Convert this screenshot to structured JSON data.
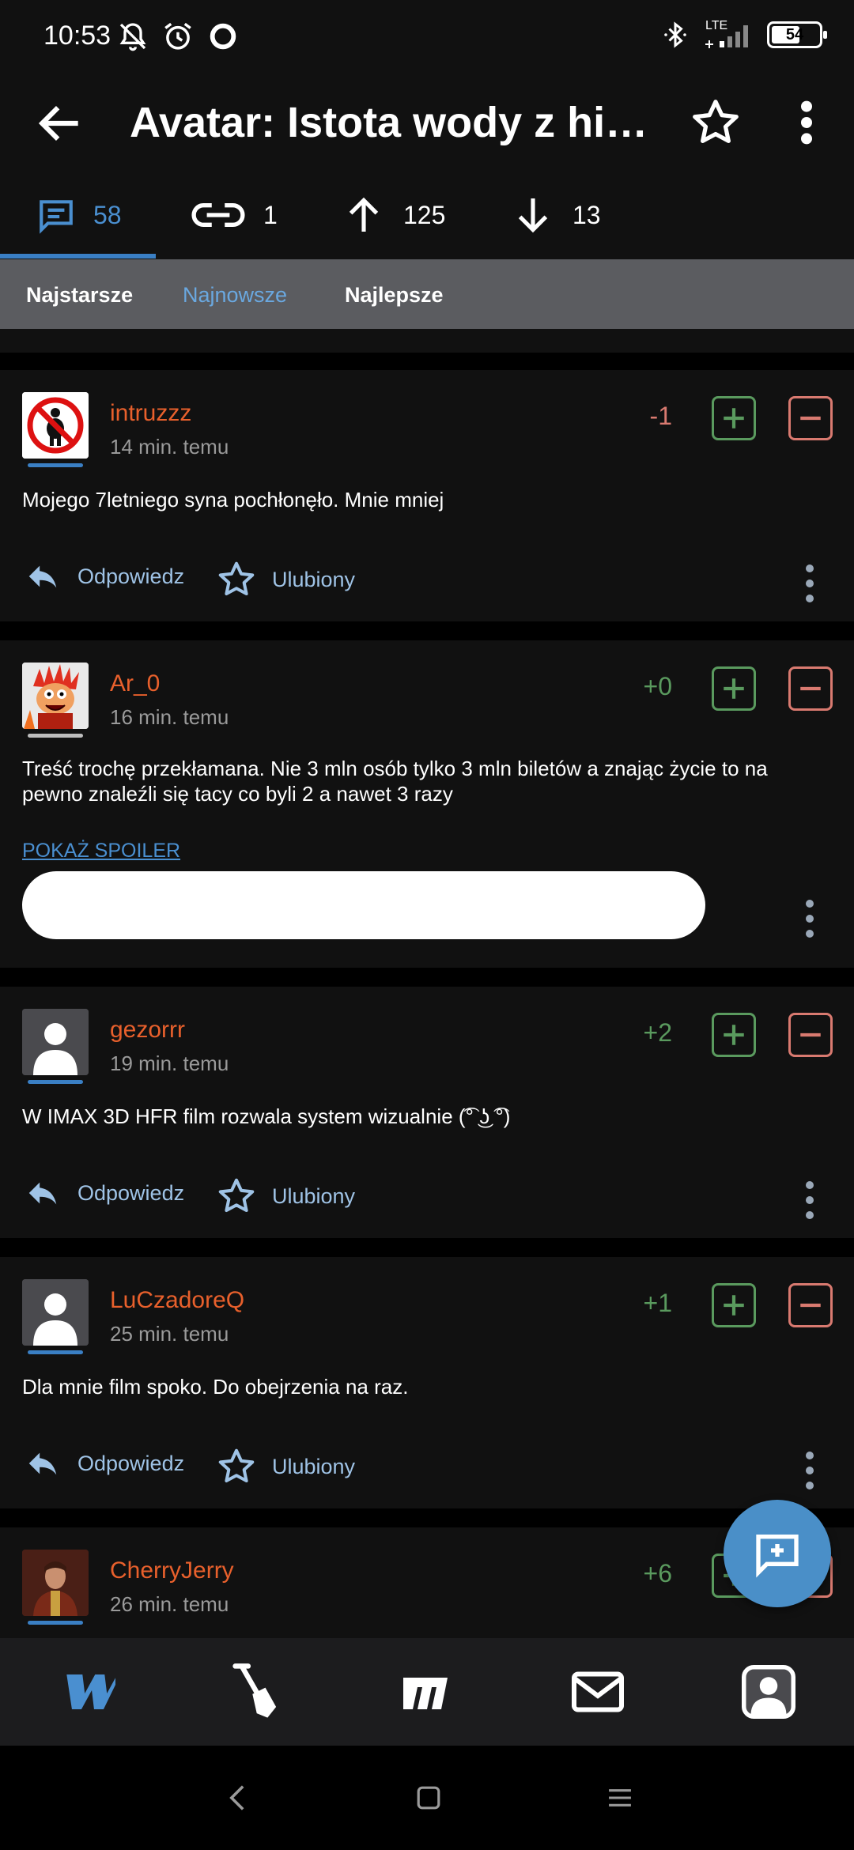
{
  "status_bar": {
    "time": "10:53",
    "network": "LTE",
    "battery": "54",
    "icons": [
      "bell-off-icon",
      "alarm-icon",
      "record-icon",
      "bluetooth-icon",
      "signal-icon",
      "battery-icon"
    ]
  },
  "app_bar": {
    "title": "Avatar: Istota wody z hist..."
  },
  "stats": {
    "comments": "58",
    "links": "1",
    "upvotes": "125",
    "downvotes": "13"
  },
  "sort": {
    "oldest": "Najstarsze",
    "newest": "Najnowsze",
    "best": "Najlepsze",
    "active": "Najnowsze"
  },
  "actions": {
    "reply": "Odpowiedz",
    "favorite": "Ulubiony"
  },
  "comments": [
    {
      "username": "intruzzz",
      "time": "14 min. temu",
      "score": "-1",
      "text": "Mojego 7letniego syna pochłonęło. Mnie mniej"
    },
    {
      "username": "Ar_0",
      "time": "16 min. temu",
      "score": "+0",
      "text": "Treść trochę przekłamana. Nie 3 mln osób tylko 3 mln biletów a znając życie to na pewno znaleźli się tacy co byli 2 a nawet 3 razy",
      "spoiler": "POKAŻ SPOILER"
    },
    {
      "username": "gezorrr",
      "time": "19 min. temu",
      "score": "+2",
      "text": "W IMAX 3D HFR film rozwala system wizualnie (͡° ͜ʖ ͡°)"
    },
    {
      "username": "LuCzadoreQ",
      "time": "25 min. temu",
      "score": "+1",
      "text": "Dla mnie film spoko. Do obejrzenia na raz."
    },
    {
      "username": "CherryJerry",
      "time": "26 min. temu",
      "score": "+6"
    }
  ],
  "colors": {
    "accent": "#4a8fd0",
    "username": "#e8602c",
    "positive": "#5a9a5e",
    "negative": "#d97a70",
    "card_bg": "#111111",
    "sort_bar_bg": "#5b5c60"
  },
  "bottom_nav": [
    "wykop-logo-icon",
    "shovel-icon",
    "mikroblog-icon",
    "mail-icon",
    "profile-icon"
  ],
  "system_nav": [
    "back-icon",
    "home-icon",
    "recents-icon"
  ]
}
